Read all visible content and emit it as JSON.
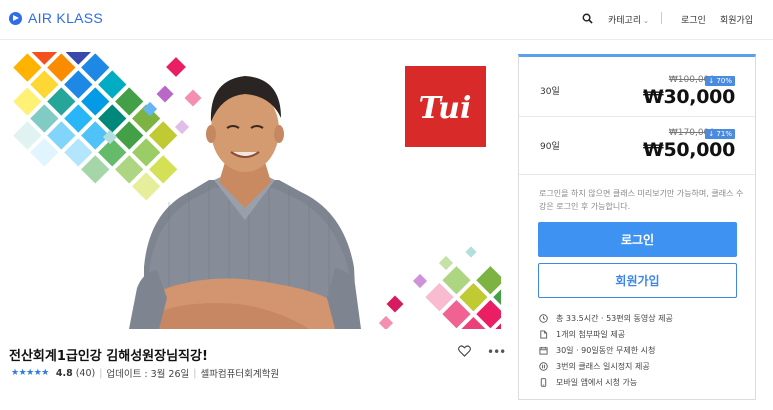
{
  "header": {
    "logo_text": "AIR KLASS",
    "nav_category": "카테고리",
    "nav_login": "로그인",
    "nav_signup": "회원가입"
  },
  "hero": {
    "brand_mark_text": "Tui"
  },
  "course": {
    "title": "전산회계1급인강 김해성원장님직강!",
    "stars": "★★★★★",
    "rating": "4.8",
    "review_count": "(40)",
    "updated": "업데이트 : 3월 26일",
    "institute": "셀파컴퓨터회계학원"
  },
  "pricing": {
    "plans": [
      {
        "label": "30일",
        "old_price": "₩100,000",
        "discount": "↓ 70%",
        "price": "₩30,000"
      },
      {
        "label": "90일",
        "old_price": "₩170,000",
        "discount": "↓ 71%",
        "price": "₩50,000"
      }
    ],
    "notice": "로그인을 하지 않으면 클래스 미리보기만 가능하며, 클래스 수강은 로그인 후 가능합니다.",
    "login_button": "로그인",
    "signup_button": "회원가입",
    "features": [
      {
        "icon": "clock-icon",
        "text": "총 33.5시간 · 53편의 동영상 제공"
      },
      {
        "icon": "attachment-icon",
        "text": "1개의 첨부파일 제공"
      },
      {
        "icon": "calendar-icon",
        "text": "30일 · 90일동안 무제한 시청"
      },
      {
        "icon": "pause-icon",
        "text": "3번의 클래스 일시정지 제공"
      },
      {
        "icon": "mobile-icon",
        "text": "모바일 앱에서 시청 가능"
      }
    ]
  },
  "colors": {
    "brand_blue": "#2f6ce5",
    "button_blue": "#3e92f1",
    "logo_red": "#d92a2a"
  }
}
